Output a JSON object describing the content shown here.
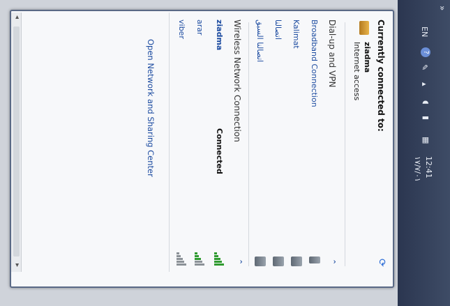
{
  "popup": {
    "header": "Currently connected to:",
    "current_network": "ziadma",
    "current_status": "Internet access",
    "refresh_icon": "refresh-icon",
    "section_dialup": "Dial-up and VPN",
    "dialup_items": [
      "Broadband Connection",
      "Kalimat",
      "اتصالنا",
      "اتصالنا السبق"
    ],
    "section_wireless": "Wireless Network Connection",
    "wireless_items": [
      {
        "name": "ziadma",
        "status": "Connected"
      },
      {
        "name": "arar",
        "status": ""
      },
      {
        "name": "viber",
        "status": ""
      }
    ],
    "footer_link": "Open Network and Sharing Center"
  },
  "taskbar": {
    "language": "EN",
    "time": "12:41",
    "date": "١٧/٧/٠١"
  },
  "colors": {
    "link": "#1c4ba0",
    "signal_green": "#2f9a2f",
    "signal_gray": "#8b9197"
  }
}
